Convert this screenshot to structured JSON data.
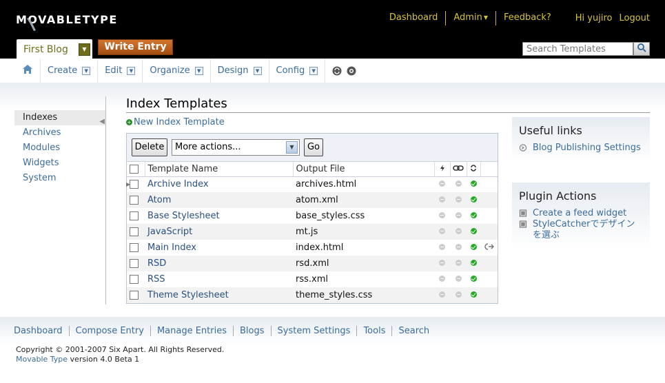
{
  "brand": {
    "logo_text": "MOVABLETYPE"
  },
  "topnav": {
    "dashboard": "Dashboard",
    "admin": "Admin",
    "feedback": "Feedback?",
    "greeting": "Hi yujiro",
    "logout": "Logout"
  },
  "blog": {
    "name": "First Blog",
    "write_entry": "Write Entry"
  },
  "search": {
    "placeholder": "Search Templates"
  },
  "menu": [
    "Create",
    "Edit",
    "Organize",
    "Design",
    "Config"
  ],
  "sidebar": {
    "items": [
      "Indexes",
      "Archives",
      "Modules",
      "Widgets",
      "System"
    ],
    "active": "Indexes"
  },
  "page": {
    "title": "Index Templates",
    "new_link": "New Index Template"
  },
  "actions": {
    "delete": "Delete",
    "more_actions": "More actions...",
    "go": "Go"
  },
  "table": {
    "headers": {
      "name": "Template Name",
      "output": "Output File"
    },
    "rows": [
      {
        "name": "Archive Index",
        "output": "archives.html",
        "published": true,
        "extra": ""
      },
      {
        "name": "Atom",
        "output": "atom.xml",
        "published": true,
        "extra": ""
      },
      {
        "name": "Base Stylesheet",
        "output": "base_styles.css",
        "published": true,
        "extra": ""
      },
      {
        "name": "JavaScript",
        "output": "mt.js",
        "published": true,
        "extra": ""
      },
      {
        "name": "Main Index",
        "output": "index.html",
        "published": true,
        "extra": "link"
      },
      {
        "name": "RSD",
        "output": "rsd.xml",
        "published": true,
        "extra": ""
      },
      {
        "name": "RSS",
        "output": "rss.xml",
        "published": true,
        "extra": ""
      },
      {
        "name": "Theme Stylesheet",
        "output": "theme_styles.css",
        "published": true,
        "extra": ""
      }
    ]
  },
  "useful_links": {
    "title": "Useful links",
    "items": [
      "Blog Publishing Settings"
    ]
  },
  "plugin_actions": {
    "title": "Plugin Actions",
    "items": [
      "Create a feed widget",
      "StyleCatcherでデザインを選ぶ"
    ]
  },
  "footer": {
    "links": [
      "Dashboard",
      "Compose Entry",
      "Manage Entries",
      "Blogs",
      "System Settings",
      "Tools",
      "Search"
    ],
    "copyright": "Copyright © 2001-2007 Six Apart. All Rights Reserved.",
    "product_link": "Movable Type",
    "version": " version 4.0 Beta 1"
  },
  "colors": {
    "topbar": "#000000",
    "accent_gold": "#d8c43c",
    "link_blue": "#3a6c9c",
    "write_entry": "#c0621f",
    "published_green": "#22aa22"
  }
}
